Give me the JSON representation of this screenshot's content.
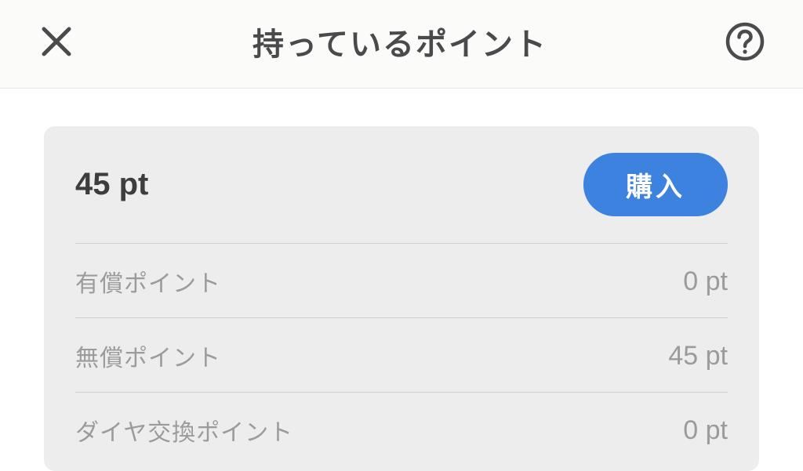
{
  "header": {
    "title": "持っているポイント"
  },
  "points": {
    "total_display": "45 pt",
    "buy_label": "購入",
    "rows": [
      {
        "label": "有償ポイント",
        "value": "0 pt"
      },
      {
        "label": "無償ポイント",
        "value": "45 pt"
      },
      {
        "label": "ダイヤ交換ポイント",
        "value": "0 pt"
      }
    ]
  },
  "colors": {
    "accent": "#3e82e0",
    "card_bg": "#ededed",
    "text_dark": "#3d3d3f",
    "text_muted": "#9b9b9b"
  }
}
